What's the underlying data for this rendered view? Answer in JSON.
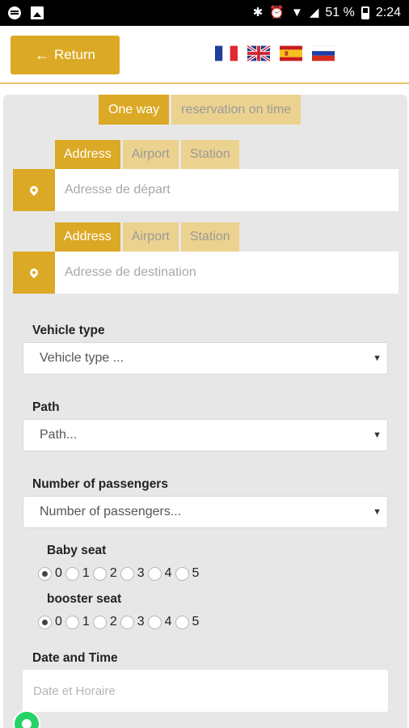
{
  "statusbar": {
    "battery": "51 %",
    "time": "2:24"
  },
  "header": {
    "return_label": "Return",
    "flags": [
      "france-flag",
      "uk-flag",
      "spain-flag",
      "russia-flag"
    ]
  },
  "trip_tabs": [
    {
      "label": "One way",
      "active": true
    },
    {
      "label": "reservation on time",
      "active": false
    }
  ],
  "departure": {
    "tabs": [
      "Address",
      "Airport",
      "Station"
    ],
    "placeholder": "Adresse de départ"
  },
  "destination": {
    "tabs": [
      "Address",
      "Airport",
      "Station"
    ],
    "placeholder": "Adresse de destination"
  },
  "vehicle": {
    "label": "Vehicle type",
    "value": "Vehicle type ..."
  },
  "path": {
    "label": "Path",
    "value": "Path..."
  },
  "passengers": {
    "label": "Number of passengers",
    "value": "Number of passengers..."
  },
  "baby_seat": {
    "label": "Baby seat",
    "options": [
      "0",
      "1",
      "2",
      "3",
      "4",
      "5"
    ],
    "selected": "0"
  },
  "booster_seat": {
    "label": "booster seat",
    "options": [
      "0",
      "1",
      "2",
      "3",
      "4",
      "5"
    ],
    "selected": "0"
  },
  "datetime": {
    "label": "Date and Time",
    "placeholder": "Date et Horaire"
  },
  "colors": {
    "accent": "#dba925",
    "accent_light": "#ecd28f",
    "panel": "#e7e7e7"
  }
}
